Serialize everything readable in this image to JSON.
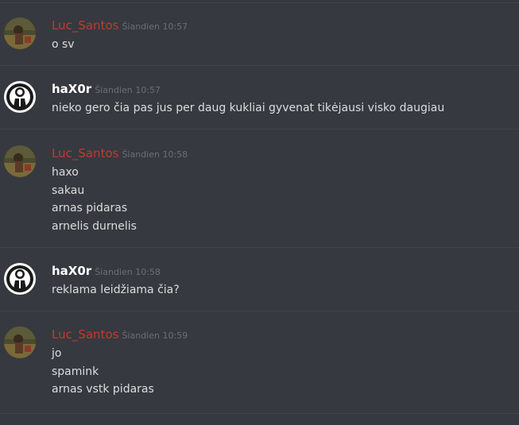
{
  "messages": [
    {
      "author": "Luc_Santos",
      "author_color": "#c4392d",
      "avatar": "game-character-avatar",
      "time": "Šiandien 10:57",
      "lines": [
        "o sv"
      ]
    },
    {
      "author": "haX0r",
      "author_color": "#ffffff",
      "avatar": "anonymous-mask-avatar",
      "time": "Šiandien 10:57",
      "lines": [
        "nieko gero čia pas jus per daug kukliai gyvenat tikėjausi visko daugiau"
      ]
    },
    {
      "author": "Luc_Santos",
      "author_color": "#c4392d",
      "avatar": "game-character-avatar",
      "time": "Šiandien 10:58",
      "lines": [
        "haxo",
        "sakau",
        "arnas pidaras",
        "arnelis durnelis"
      ]
    },
    {
      "author": "haX0r",
      "author_color": "#ffffff",
      "avatar": "anonymous-mask-avatar",
      "time": "Šiandien 10:58",
      "lines": [
        "reklama leidžiama čia?"
      ]
    },
    {
      "author": "Luc_Santos",
      "author_color": "#c4392d",
      "avatar": "game-character-avatar",
      "time": "Šiandien 10:59",
      "lines": [
        "jo",
        "spamink",
        "arnas vstk pidaras"
      ]
    }
  ]
}
